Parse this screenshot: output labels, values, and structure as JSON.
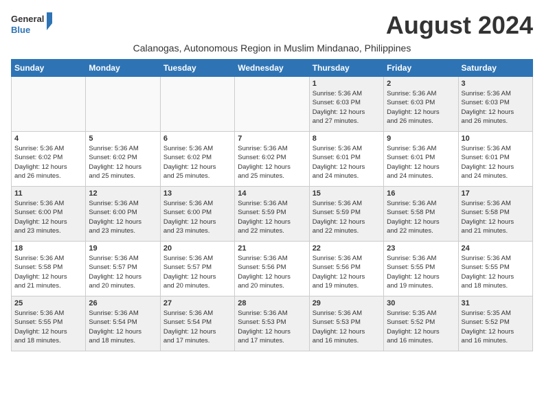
{
  "logo": {
    "line1": "General",
    "line2": "Blue"
  },
  "month_year": "August 2024",
  "subtitle": "Calanogas, Autonomous Region in Muslim Mindanao, Philippines",
  "days_of_week": [
    "Sunday",
    "Monday",
    "Tuesday",
    "Wednesday",
    "Thursday",
    "Friday",
    "Saturday"
  ],
  "weeks": [
    [
      {
        "day": "",
        "info": ""
      },
      {
        "day": "",
        "info": ""
      },
      {
        "day": "",
        "info": ""
      },
      {
        "day": "",
        "info": ""
      },
      {
        "day": "1",
        "info": "Sunrise: 5:36 AM\nSunset: 6:03 PM\nDaylight: 12 hours\nand 27 minutes."
      },
      {
        "day": "2",
        "info": "Sunrise: 5:36 AM\nSunset: 6:03 PM\nDaylight: 12 hours\nand 26 minutes."
      },
      {
        "day": "3",
        "info": "Sunrise: 5:36 AM\nSunset: 6:03 PM\nDaylight: 12 hours\nand 26 minutes."
      }
    ],
    [
      {
        "day": "4",
        "info": "Sunrise: 5:36 AM\nSunset: 6:02 PM\nDaylight: 12 hours\nand 26 minutes."
      },
      {
        "day": "5",
        "info": "Sunrise: 5:36 AM\nSunset: 6:02 PM\nDaylight: 12 hours\nand 25 minutes."
      },
      {
        "day": "6",
        "info": "Sunrise: 5:36 AM\nSunset: 6:02 PM\nDaylight: 12 hours\nand 25 minutes."
      },
      {
        "day": "7",
        "info": "Sunrise: 5:36 AM\nSunset: 6:02 PM\nDaylight: 12 hours\nand 25 minutes."
      },
      {
        "day": "8",
        "info": "Sunrise: 5:36 AM\nSunset: 6:01 PM\nDaylight: 12 hours\nand 24 minutes."
      },
      {
        "day": "9",
        "info": "Sunrise: 5:36 AM\nSunset: 6:01 PM\nDaylight: 12 hours\nand 24 minutes."
      },
      {
        "day": "10",
        "info": "Sunrise: 5:36 AM\nSunset: 6:01 PM\nDaylight: 12 hours\nand 24 minutes."
      }
    ],
    [
      {
        "day": "11",
        "info": "Sunrise: 5:36 AM\nSunset: 6:00 PM\nDaylight: 12 hours\nand 23 minutes."
      },
      {
        "day": "12",
        "info": "Sunrise: 5:36 AM\nSunset: 6:00 PM\nDaylight: 12 hours\nand 23 minutes."
      },
      {
        "day": "13",
        "info": "Sunrise: 5:36 AM\nSunset: 6:00 PM\nDaylight: 12 hours\nand 23 minutes."
      },
      {
        "day": "14",
        "info": "Sunrise: 5:36 AM\nSunset: 5:59 PM\nDaylight: 12 hours\nand 22 minutes."
      },
      {
        "day": "15",
        "info": "Sunrise: 5:36 AM\nSunset: 5:59 PM\nDaylight: 12 hours\nand 22 minutes."
      },
      {
        "day": "16",
        "info": "Sunrise: 5:36 AM\nSunset: 5:58 PM\nDaylight: 12 hours\nand 22 minutes."
      },
      {
        "day": "17",
        "info": "Sunrise: 5:36 AM\nSunset: 5:58 PM\nDaylight: 12 hours\nand 21 minutes."
      }
    ],
    [
      {
        "day": "18",
        "info": "Sunrise: 5:36 AM\nSunset: 5:58 PM\nDaylight: 12 hours\nand 21 minutes."
      },
      {
        "day": "19",
        "info": "Sunrise: 5:36 AM\nSunset: 5:57 PM\nDaylight: 12 hours\nand 20 minutes."
      },
      {
        "day": "20",
        "info": "Sunrise: 5:36 AM\nSunset: 5:57 PM\nDaylight: 12 hours\nand 20 minutes."
      },
      {
        "day": "21",
        "info": "Sunrise: 5:36 AM\nSunset: 5:56 PM\nDaylight: 12 hours\nand 20 minutes."
      },
      {
        "day": "22",
        "info": "Sunrise: 5:36 AM\nSunset: 5:56 PM\nDaylight: 12 hours\nand 19 minutes."
      },
      {
        "day": "23",
        "info": "Sunrise: 5:36 AM\nSunset: 5:55 PM\nDaylight: 12 hours\nand 19 minutes."
      },
      {
        "day": "24",
        "info": "Sunrise: 5:36 AM\nSunset: 5:55 PM\nDaylight: 12 hours\nand 18 minutes."
      }
    ],
    [
      {
        "day": "25",
        "info": "Sunrise: 5:36 AM\nSunset: 5:55 PM\nDaylight: 12 hours\nand 18 minutes."
      },
      {
        "day": "26",
        "info": "Sunrise: 5:36 AM\nSunset: 5:54 PM\nDaylight: 12 hours\nand 18 minutes."
      },
      {
        "day": "27",
        "info": "Sunrise: 5:36 AM\nSunset: 5:54 PM\nDaylight: 12 hours\nand 17 minutes."
      },
      {
        "day": "28",
        "info": "Sunrise: 5:36 AM\nSunset: 5:53 PM\nDaylight: 12 hours\nand 17 minutes."
      },
      {
        "day": "29",
        "info": "Sunrise: 5:36 AM\nSunset: 5:53 PM\nDaylight: 12 hours\nand 16 minutes."
      },
      {
        "day": "30",
        "info": "Sunrise: 5:35 AM\nSunset: 5:52 PM\nDaylight: 12 hours\nand 16 minutes."
      },
      {
        "day": "31",
        "info": "Sunrise: 5:35 AM\nSunset: 5:52 PM\nDaylight: 12 hours\nand 16 minutes."
      }
    ]
  ]
}
